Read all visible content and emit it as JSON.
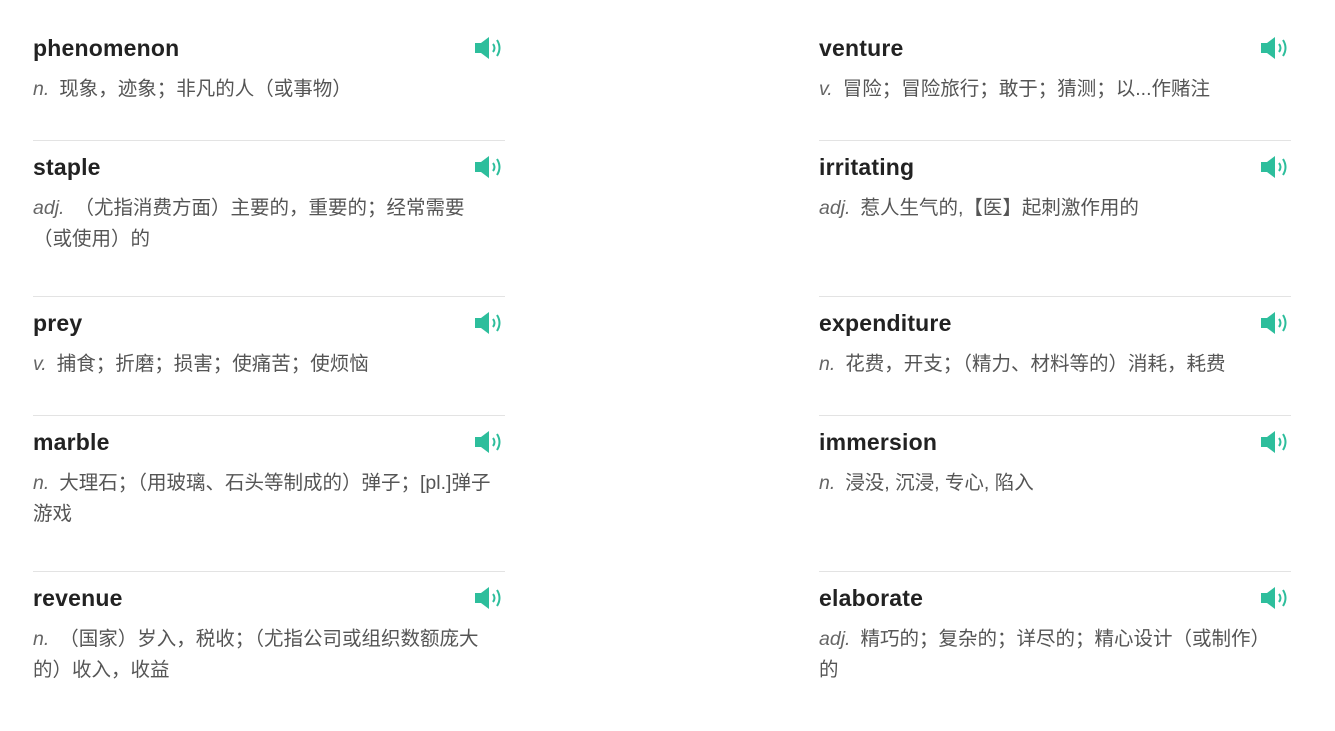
{
  "theme": {
    "speaker_color": "#2dbe9c"
  },
  "left": [
    {
      "word": "phenomenon",
      "pos": "n.",
      "def": "现象，迹象；非凡的人（或事物）",
      "size": "sm"
    },
    {
      "word": "staple",
      "pos": "adj.",
      "def": "（尤指消费方面）主要的，重要的；经常需要（或使用）的",
      "size": "lg"
    },
    {
      "word": "prey",
      "pos": "v.",
      "def": "捕食；折磨；损害；使痛苦；使烦恼",
      "size": "sm"
    },
    {
      "word": "marble",
      "pos": "n.",
      "def": "大理石；（用玻璃、石头等制成的）弹子；[pl.]弹子游戏",
      "size": "lg"
    },
    {
      "word": "revenue",
      "pos": "n.",
      "def": "（国家）岁入，税收；（尤指公司或组织数额庞大的）收入，收益",
      "size": "lg"
    }
  ],
  "right": [
    {
      "word": "venture",
      "pos": "v.",
      "def": "冒险；冒险旅行；敢于；猜测；以...作赌注",
      "size": "sm"
    },
    {
      "word": "irritating",
      "pos": "adj.",
      "def": "惹人生气的,【医】起刺激作用的",
      "size": "lg"
    },
    {
      "word": "expenditure",
      "pos": "n.",
      "def": "花费，开支；（精力、材料等的）消耗，耗费",
      "size": "sm"
    },
    {
      "word": "immersion",
      "pos": "n.",
      "def": "浸没, 沉浸, 专心, 陷入",
      "size": "lg"
    },
    {
      "word": "elaborate",
      "pos": "adj.",
      "def": "精巧的；复杂的；详尽的；精心设计（或制作）的",
      "size": "lg"
    }
  ]
}
